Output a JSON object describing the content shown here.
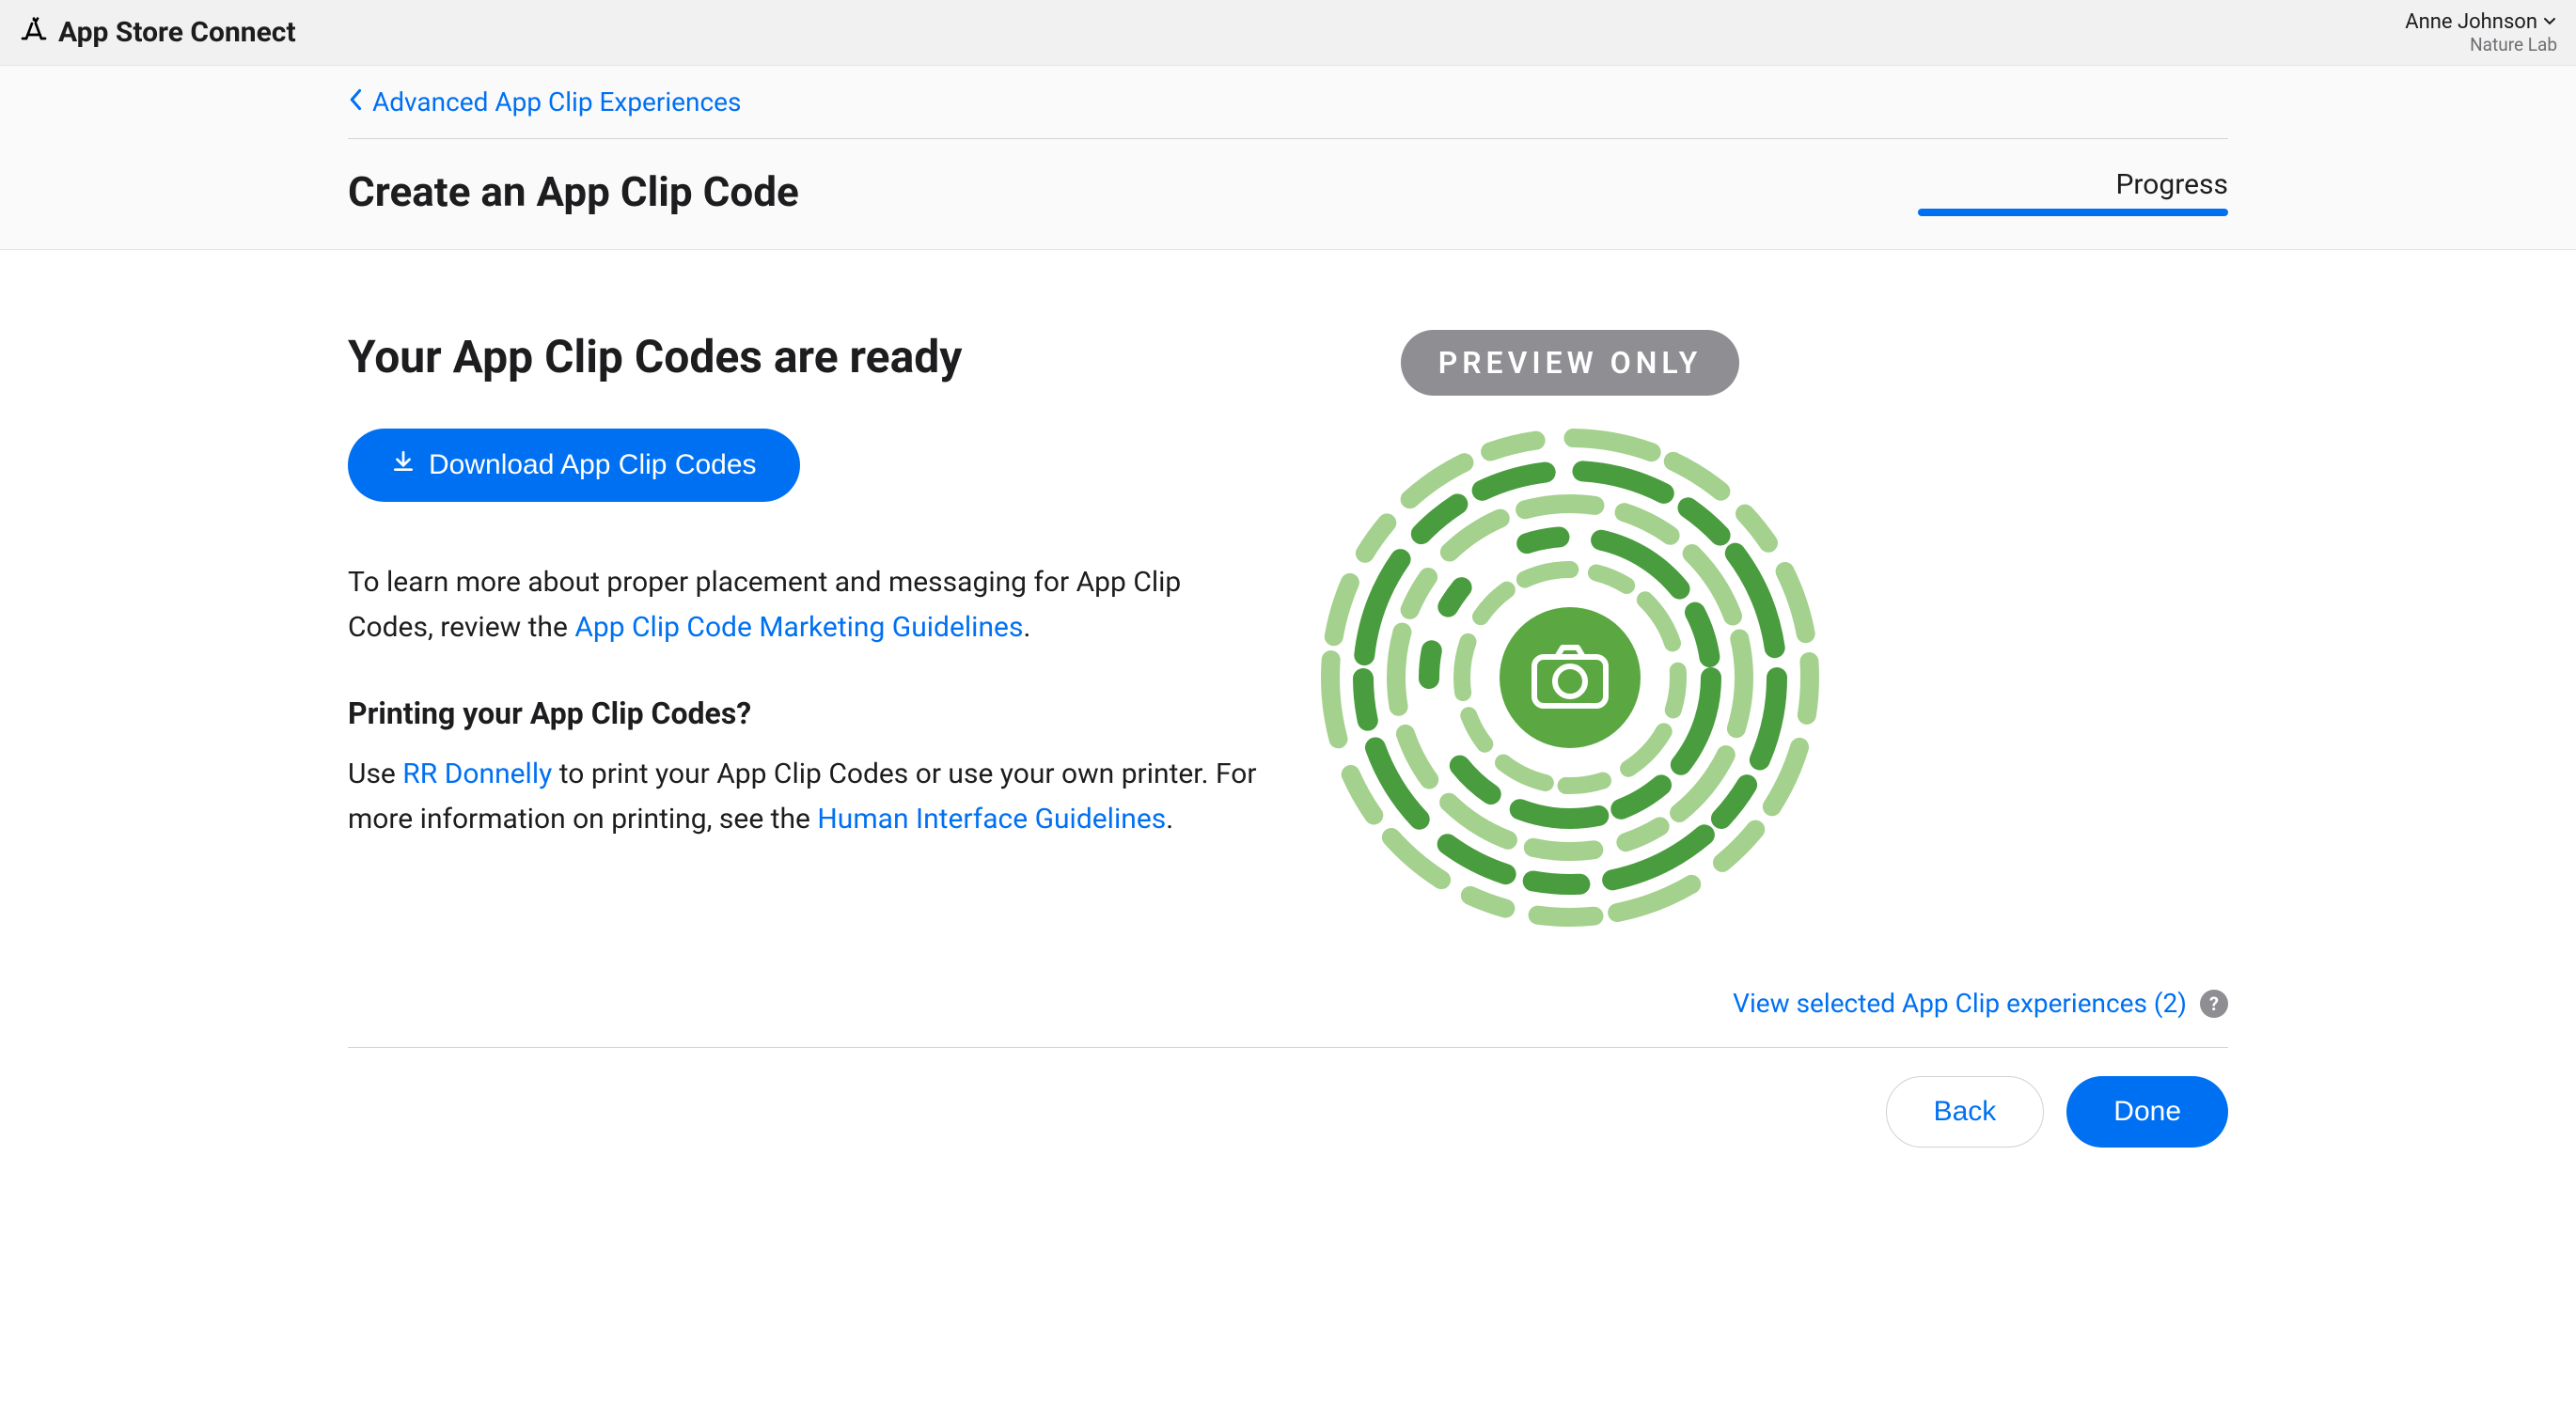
{
  "header": {
    "app_title": "App Store Connect",
    "user_name": "Anne Johnson",
    "user_org": "Nature Lab"
  },
  "subheader": {
    "breadcrumb": "Advanced App Clip Experiences",
    "page_title": "Create an App Clip Code",
    "progress_label": "Progress"
  },
  "main": {
    "ready_heading": "Your App Clip Codes are ready",
    "download_button": "Download App Clip Codes",
    "learn_text_1": "To learn more about proper placement and messaging for App Clip Codes, review the ",
    "learn_link_1": "App Clip Code Marketing Guidelines",
    "learn_text_1_end": ".",
    "print_heading": "Printing your App Clip Codes?",
    "print_text_1": "Use ",
    "print_link_1": "RR Donnelly",
    "print_text_2": " to print your App Clip Codes or use your own printer. For more information on printing, see the ",
    "print_link_2": "Human Interface Guidelines",
    "print_text_end": ".",
    "preview_badge": "PREVIEW ONLY",
    "view_selected": "View selected App Clip experiences (2)"
  },
  "footer": {
    "back_button": "Back",
    "done_button": "Done"
  }
}
